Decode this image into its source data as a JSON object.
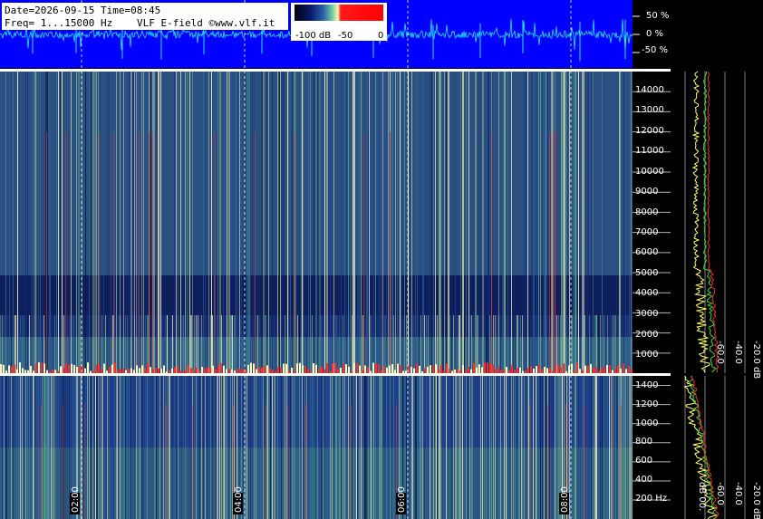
{
  "chart_data": {
    "type": "heatmap",
    "header": {
      "line1": "Date=2026-09-15 Time=08:45",
      "line2_prefix": "Freq= 1...15000 Hz",
      "line2_suffix": "VLF E-field ©www.vlf.it"
    },
    "colorbar": {
      "tick_labels": [
        "-100 dB",
        "-50",
        "0"
      ],
      "range_db": [
        -100,
        0
      ]
    },
    "waveform": {
      "tick_labels": [
        "50 %",
        "0 %",
        "-50 %"
      ],
      "ticks_percent": [
        50,
        0,
        -50
      ]
    },
    "upper_spectrogram": {
      "freq_range_hz": [
        1,
        15000
      ],
      "freq_ticks": [
        1000,
        2000,
        3000,
        4000,
        5000,
        6000,
        7000,
        8000,
        9000,
        10000,
        11000,
        12000,
        13000,
        14000
      ],
      "freq_tick_labels": [
        "1000",
        "2000",
        "3000",
        "4000",
        "5000",
        "6000",
        "7000",
        "8000",
        "9000",
        "10000",
        "11000",
        "12000",
        "13000",
        "14000"
      ],
      "db_tick_labels": [
        "-60.0",
        "-40.0",
        "-20.0 dB"
      ]
    },
    "lower_spectrogram": {
      "freq_range_hz": [
        1,
        1500
      ],
      "freq_ticks": [
        200,
        400,
        600,
        800,
        1000,
        1200,
        1400
      ],
      "freq_tick_labels": [
        "200 Hz",
        "400",
        "600",
        "800",
        "1000",
        "1200",
        "1400"
      ],
      "db_tick_labels": [
        "dB 00.",
        "-60.0",
        "-40.0",
        "-20.0 dB"
      ]
    },
    "time_axis": {
      "labels": [
        "02:00",
        "04:00",
        "06:00",
        "08:00"
      ]
    },
    "colors": {
      "waveform_bg": "#0000ff",
      "waveform_trace": "#22e6ff",
      "spectrum_avg": "#ffff66",
      "spectrum_peak": "#ff2a2a",
      "spectrum_mid": "#33dd33"
    }
  }
}
